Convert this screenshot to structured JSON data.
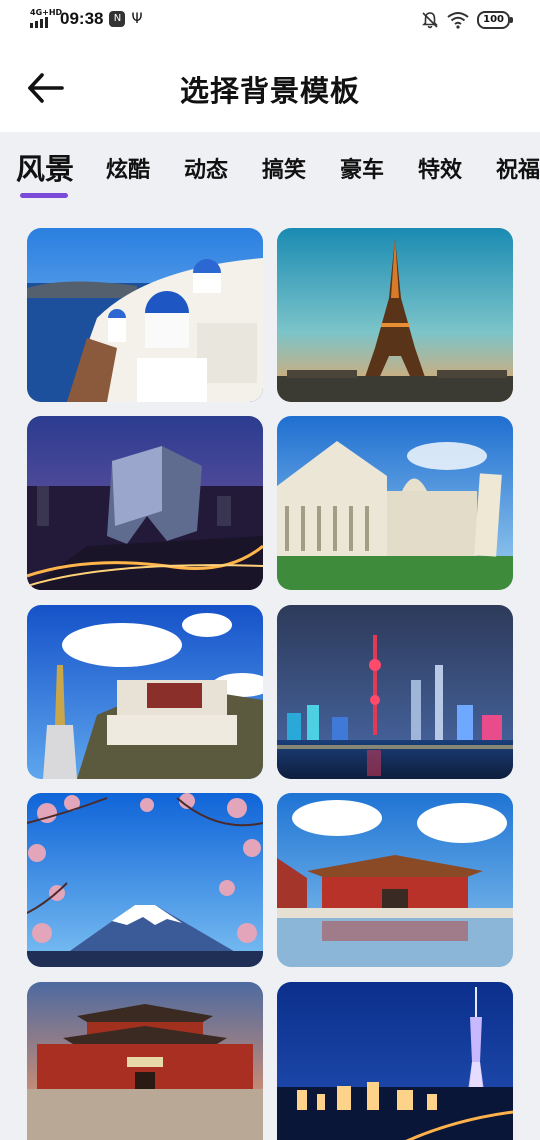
{
  "status_bar": {
    "network": "4G+HD",
    "time": "09:38",
    "notification_badge": "N",
    "battery": "100"
  },
  "header": {
    "title": "选择背景模板"
  },
  "tabs": [
    {
      "label": "风景",
      "active": true
    },
    {
      "label": "炫酷",
      "active": false
    },
    {
      "label": "动态",
      "active": false
    },
    {
      "label": "搞笑",
      "active": false
    },
    {
      "label": "豪车",
      "active": false
    },
    {
      "label": "特效",
      "active": false
    },
    {
      "label": "祝福",
      "active": false
    }
  ],
  "colors": {
    "accent": "#7b4ad8",
    "background": "#eef0f3"
  },
  "templates": [
    {
      "scene": "santorini-blue-domes"
    },
    {
      "scene": "eiffel-tower-sunset"
    },
    {
      "scene": "cctv-tower-night"
    },
    {
      "scene": "pisa-cathedral"
    },
    {
      "scene": "potala-palace"
    },
    {
      "scene": "shanghai-skyline-night"
    },
    {
      "scene": "mount-fuji-cherry-blossom"
    },
    {
      "scene": "forbidden-city-reflection"
    },
    {
      "scene": "forbidden-city-gate"
    },
    {
      "scene": "canton-tower-night"
    }
  ]
}
